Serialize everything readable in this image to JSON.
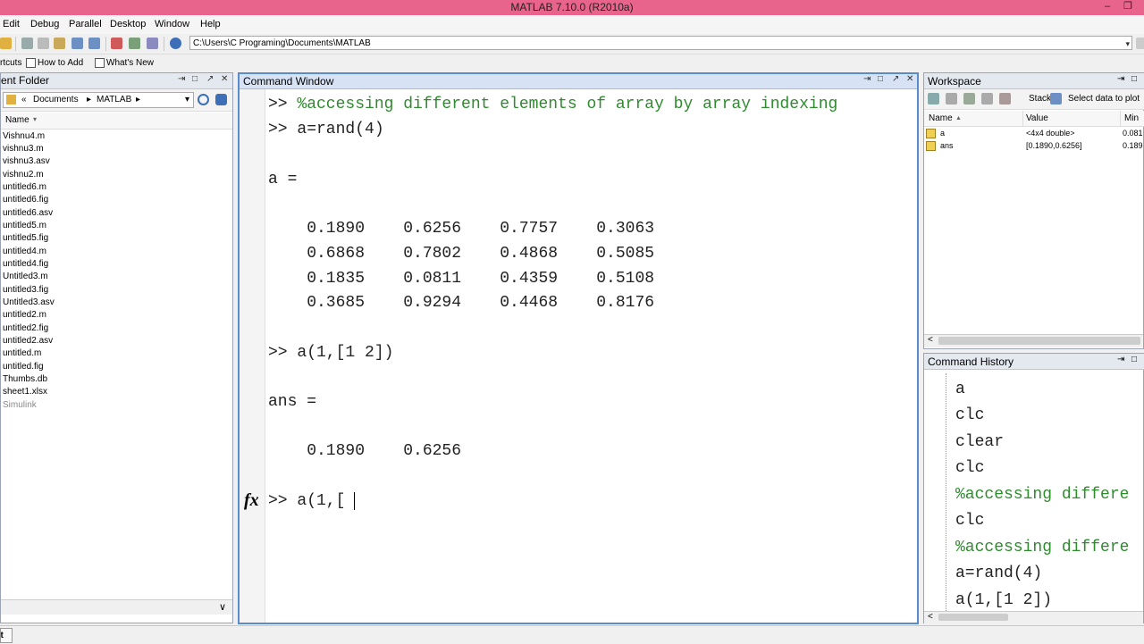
{
  "window": {
    "title": "MATLAB  7.10.0 (R2010a)",
    "min": "–",
    "restore": "❐"
  },
  "menu": [
    "Edit",
    "Debug",
    "Parallel",
    "Desktop",
    "Window",
    "Help"
  ],
  "toolbar": {
    "path": "C:\\Users\\C Programing\\Documents\\MATLAB",
    "dropdown": "▾"
  },
  "shortcuts": {
    "label": "rtcuts",
    "how_to_add": "How to Add",
    "whats_new": "What's New"
  },
  "current_folder": {
    "title": "ent Folder",
    "nav": {
      "prefix": "«",
      "crumb1": "Documents",
      "sep": "▸",
      "crumb2": "MATLAB",
      "sep2": "▸",
      "dropdown": "▾"
    },
    "column_name": "Name",
    "sort_arrow": "▾",
    "files": [
      "Vishnu4.m",
      "vishnu3.m",
      "vishnu3.asv",
      "vishnu2.m",
      "untitled6.m",
      "untitled6.fig",
      "untitled6.asv",
      "untitled5.m",
      "untitled5.fig",
      "untitled4.m",
      "untitled4.fig",
      "Untitled3.m",
      "untitled3.fig",
      "Untitled3.asv",
      "untitled2.m",
      "untitled2.fig",
      "untitled2.asv",
      "untitled.m",
      "untitled.fig",
      "Thumbs.db",
      "sheet1.xlsx"
    ],
    "simulink": "Simulink",
    "bottom_chevron": "∨"
  },
  "command_window": {
    "title": "Command Window",
    "lines": [
      {
        "prompt": ">> ",
        "text": "%accessing different elements of array by array indexing",
        "comment": true
      },
      {
        "prompt": ">> ",
        "text": "a=rand(4)",
        "comment": false
      },
      {
        "prompt": "",
        "text": "a =",
        "comment": false
      },
      {
        "prompt": "",
        "text": "    0.1890    0.6256    0.7757    0.3063",
        "comment": false
      },
      {
        "prompt": "",
        "text": "    0.6868    0.7802    0.4868    0.5085",
        "comment": false
      },
      {
        "prompt": "",
        "text": "    0.1835    0.0811    0.4359    0.5108",
        "comment": false
      },
      {
        "prompt": "",
        "text": "    0.3685    0.9294    0.4468    0.8176",
        "comment": false
      },
      {
        "prompt": ">> ",
        "text": "a(1,[1 2])",
        "comment": false
      },
      {
        "prompt": "",
        "text": "ans =",
        "comment": false
      },
      {
        "prompt": "",
        "text": "    0.1890    0.6256",
        "comment": false
      },
      {
        "prompt": ">> ",
        "text": "a(1,[",
        "comment": false
      }
    ],
    "fx": "fx"
  },
  "workspace": {
    "title": "Workspace",
    "stack_label": "Stack:",
    "select_plot": "Select data to plot",
    "columns": {
      "name": "Name",
      "value": "Value",
      "min": "Min"
    },
    "sort_arrow": "▲",
    "variables": [
      {
        "name": "a",
        "value": "<4x4 double>",
        "min": "0.081"
      },
      {
        "name": "ans",
        "value": "[0.1890,0.6256]",
        "min": "0.189"
      }
    ],
    "scroll_left": "<"
  },
  "command_history": {
    "title": "Command History",
    "items": [
      {
        "text": "a",
        "comment": false
      },
      {
        "text": "clc",
        "comment": false
      },
      {
        "text": "clear",
        "comment": false
      },
      {
        "text": "clc",
        "comment": false
      },
      {
        "text": "%accessing differe",
        "comment": true
      },
      {
        "text": "clc",
        "comment": false
      },
      {
        "text": "%accessing differe",
        "comment": true
      },
      {
        "text": "a=rand(4)",
        "comment": false
      },
      {
        "text": "a(1,[1 2])",
        "comment": false
      }
    ],
    "scroll_left": "<"
  },
  "statusbar": {
    "start": "art"
  },
  "panel_buttons": {
    "undock": "⇥",
    "max": "□",
    "pin": "↗",
    "close": "✕"
  }
}
